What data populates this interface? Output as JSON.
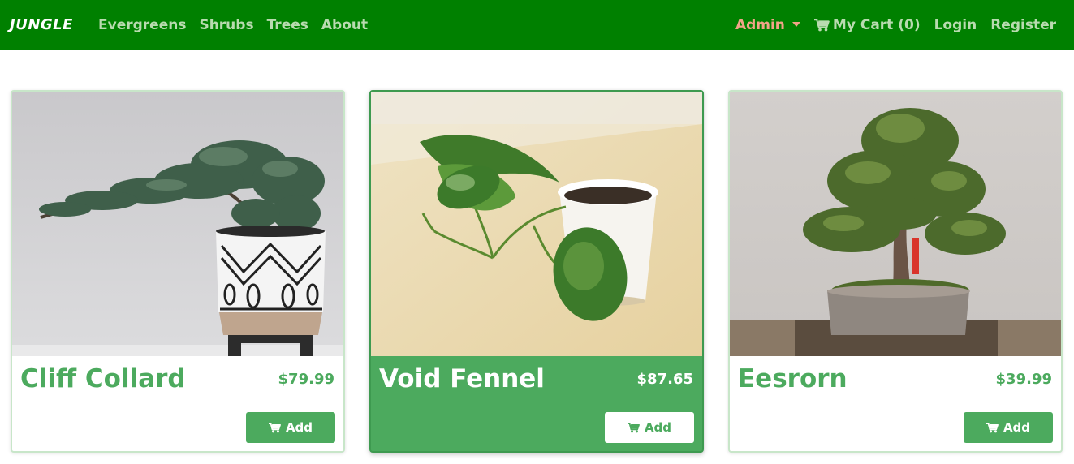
{
  "navbar": {
    "brand": "JUNGLE",
    "links": [
      {
        "label": "Evergreens"
      },
      {
        "label": "Shrubs"
      },
      {
        "label": "Trees"
      },
      {
        "label": "About"
      }
    ],
    "admin_label": "Admin",
    "cart_label": "My Cart (0)",
    "login_label": "Login",
    "register_label": "Register",
    "cart_icon": "shopping-cart-icon",
    "colors": {
      "bar": "#008000",
      "link": "#b9dbb0",
      "admin": "#f1a488"
    }
  },
  "products": [
    {
      "name": "Cliff Collard",
      "price": "$79.99",
      "add_label": "Add",
      "image": "bonsai in patterned pot",
      "highlighted": false
    },
    {
      "name": "Void Fennel",
      "price": "$87.65",
      "add_label": "Add",
      "image": "pothos cutting in white pot",
      "highlighted": true
    },
    {
      "name": "Eesrorn",
      "price": "$39.99",
      "add_label": "Add",
      "image": "bonsai tree in tray",
      "highlighted": false
    }
  ],
  "colors": {
    "accent": "#4caa5e",
    "card_border": "#c8e6c9"
  }
}
